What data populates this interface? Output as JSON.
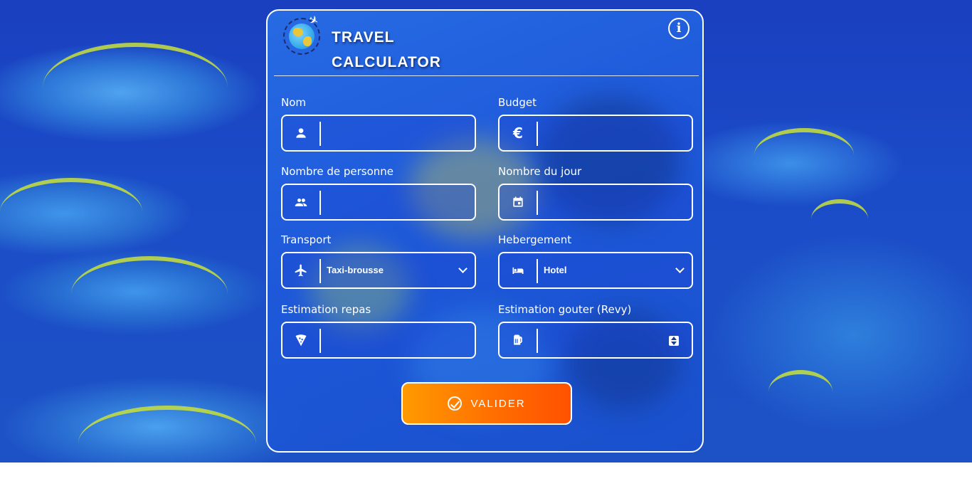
{
  "app": {
    "title_line1": "TRAVEL",
    "title_line2": "CALCULATOR",
    "info_label": "i"
  },
  "form": {
    "nom": {
      "label": "Nom",
      "value": ""
    },
    "budget": {
      "label": "Budget",
      "value": "",
      "icon_text": "€"
    },
    "personnes": {
      "label": "Nombre de personne",
      "value": ""
    },
    "jours": {
      "label": "Nombre du jour",
      "value": ""
    },
    "transport": {
      "label": "Transport",
      "selected": "Taxi-brousse"
    },
    "hebergement": {
      "label": "Hebergement",
      "selected": "Hotel"
    },
    "repas": {
      "label": "Estimation repas",
      "value": ""
    },
    "gouter": {
      "label": "Estimation gouter (Revy)",
      "value": ""
    }
  },
  "actions": {
    "submit_label": "VALIDER"
  },
  "colors": {
    "card_border": "#ffffff",
    "button_gradient_start": "#ff9a00",
    "button_gradient_end": "#ff5100",
    "background": "#1b4cc8"
  },
  "icons": {
    "nom": "person-icon",
    "budget": "euro-icon",
    "personnes": "people-icon",
    "jours": "calendar-icon",
    "transport": "airplane-icon",
    "hebergement": "bed-icon",
    "repas": "pizza-icon",
    "gouter": "beer-mug-icon"
  }
}
